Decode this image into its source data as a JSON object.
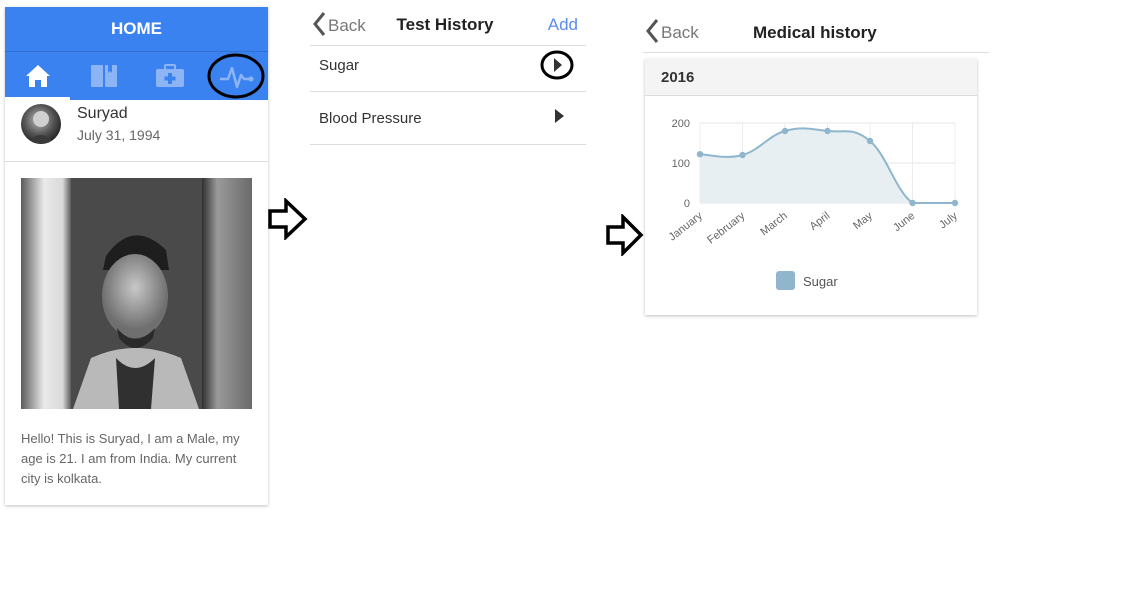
{
  "home_screen": {
    "header_title": "HOME",
    "tabs": [
      {
        "icon": "home-icon"
      },
      {
        "icon": "book-icon"
      },
      {
        "icon": "medical-kit-icon"
      },
      {
        "icon": "heartbeat-icon"
      }
    ],
    "profile": {
      "name": "Suryad",
      "dob": "July 31, 1994"
    },
    "bio": "Hello! This is Suryad, I am a Male, my age is 21. I am from India. My current city is kolkata."
  },
  "test_history": {
    "back_label": "Back",
    "title": "Test History",
    "add_label": "Add",
    "items": [
      {
        "label": "Sugar"
      },
      {
        "label": "Blood Pressure"
      }
    ]
  },
  "medical_history": {
    "back_label": "Back",
    "title": "Medical history",
    "year": "2016"
  },
  "colors": {
    "primary": "#3b82f1",
    "link": "#5b8def",
    "series": "#8fb6cc",
    "series_fill": "#e7eff3"
  },
  "chart_data": {
    "type": "area",
    "categories": [
      "January",
      "February",
      "March",
      "April",
      "May",
      "June",
      "July"
    ],
    "series": [
      {
        "name": "Sugar",
        "values": [
          122,
          120,
          180,
          180,
          155,
          0,
          0
        ]
      }
    ],
    "yticks": [
      "0",
      "100",
      "200"
    ],
    "ylim": [
      0,
      200
    ],
    "grid": true,
    "legend": "bottom"
  }
}
